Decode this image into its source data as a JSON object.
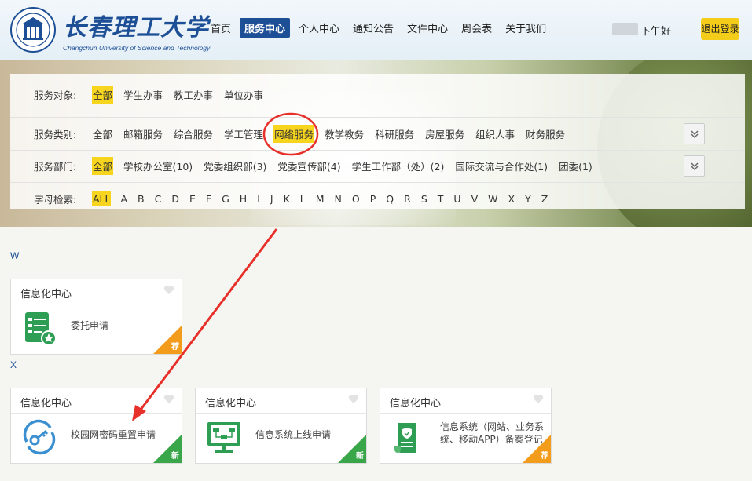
{
  "header": {
    "brand_cn": "长春理工大学",
    "brand_en": "Changchun University of Science and Technology",
    "nav": [
      "首页",
      "服务中心",
      "个人中心",
      "通知公告",
      "文件中心",
      "周会表",
      "关于我们"
    ],
    "active_nav": "服务中心",
    "greeting": "下午好",
    "logout_label": "退出登录"
  },
  "filters": {
    "object": {
      "label": "服务对象:",
      "options": [
        "全部",
        "学生办事",
        "教工办事",
        "单位办事"
      ],
      "selected": "全部"
    },
    "category": {
      "label": "服务类别:",
      "options": [
        "全部",
        "邮箱服务",
        "综合服务",
        "学工管理",
        "网络服务",
        "教学教务",
        "科研服务",
        "房屋服务",
        "组织人事",
        "财务服务"
      ],
      "selected": "网络服务"
    },
    "department": {
      "label": "服务部门:",
      "options": [
        "全部",
        "学校办公室(10)",
        "党委组织部(3)",
        "党委宣传部(4)",
        "学生工作部（处）(2)",
        "国际交流与合作处(1)",
        "团委(1)"
      ],
      "selected": "全部"
    },
    "letter": {
      "label": "字母检索:",
      "options": [
        "ALL",
        "A",
        "B",
        "C",
        "D",
        "E",
        "F",
        "G",
        "H",
        "I",
        "J",
        "K",
        "L",
        "M",
        "N",
        "O",
        "P",
        "Q",
        "R",
        "S",
        "T",
        "U",
        "V",
        "W",
        "X",
        "Y",
        "Z"
      ],
      "selected": "ALL"
    }
  },
  "sections": [
    {
      "letter": "W",
      "cards": [
        {
          "dept": "信息化中心",
          "title": "委托申请",
          "badge": "荐",
          "icon": "form-star-icon"
        }
      ]
    },
    {
      "letter": "X",
      "cards": [
        {
          "dept": "信息化中心",
          "title": "校园网密码重置申请",
          "badge": "新",
          "icon": "key-reset-icon"
        },
        {
          "dept": "信息化中心",
          "title": "信息系统上线申请",
          "badge": "新",
          "icon": "monitor-flow-icon"
        },
        {
          "dept": "信息化中心",
          "title": "信息系统（网站、业务系统、移动APP）备案登记",
          "badge": "荐",
          "icon": "shield-document-icon"
        }
      ]
    }
  ],
  "colors": {
    "brand": "#1d4f96",
    "highlight": "#f7d51e",
    "badge_new": "#3aa64a",
    "badge_recommend": "#f39c1c",
    "annotation": "#e8302a"
  }
}
